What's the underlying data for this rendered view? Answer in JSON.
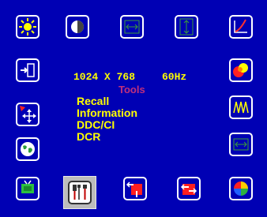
{
  "osd": {
    "resolution": "1024 X 768",
    "refresh": "60Hz",
    "menu_title": "Tools",
    "menu_items": [
      "Recall",
      "Information",
      "DDC/CI",
      "DCR"
    ]
  },
  "icons": [
    "brightness-icon",
    "contrast-icon",
    "h-position-icon",
    "v-position-icon",
    "gamma-icon",
    "input-source-icon",
    "color-icon",
    "osd-position-icon",
    "phase-icon",
    "language-icon",
    "clock-icon",
    "picture-icon",
    "tools-icon",
    "auto-adjust-icon",
    "swap-icon",
    "color-temp-icon"
  ],
  "colors": {
    "osd_background": "#0000b4",
    "text_accent": "#ffff00",
    "title_color": "#c0307c",
    "selection_frame": "#bcbcbc"
  }
}
